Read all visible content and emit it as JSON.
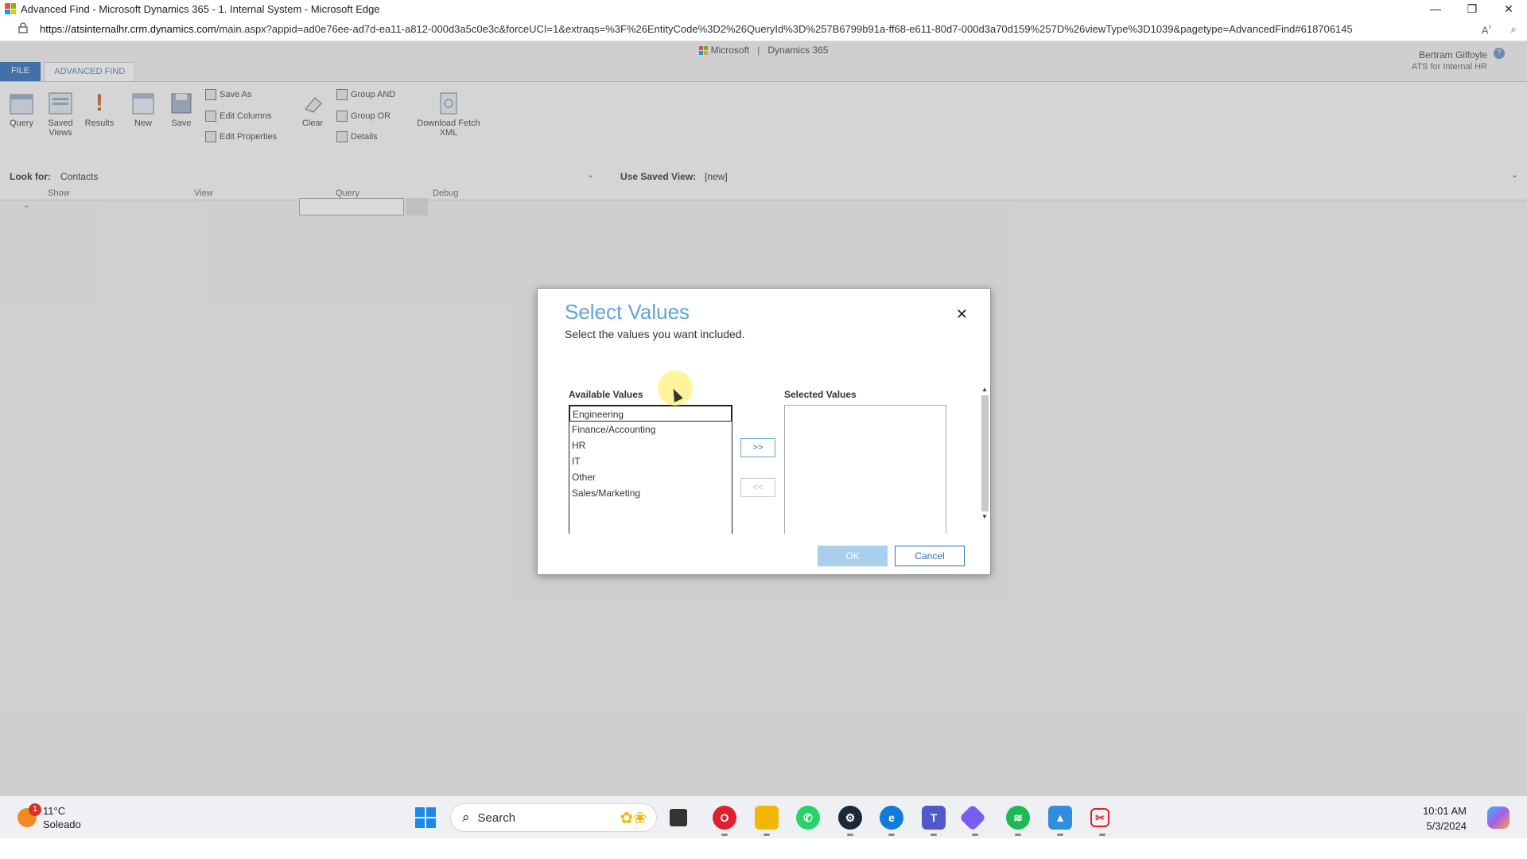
{
  "browser": {
    "window_title": "Advanced Find - Microsoft Dynamics 365 - 1. Internal System - Microsoft Edge",
    "url_host": "https://atsinternalhr.crm.dynamics.com",
    "url_path": "/main.aspx?appid=ad0e76ee-ad7d-ea11-a812-000d3a5c0e3c&forceUCI=1&extraqs=%3F%26EntityCode%3D2%26QueryId%3D%257B6799b91a-ff68-e611-80d7-000d3a70d159%257D%26viewType%3D1039&pagetype=AdvancedFind#618706145",
    "controls": {
      "minimize": "—",
      "restore": "❐",
      "close": "✕"
    }
  },
  "crm": {
    "header_brand": "Microsoft",
    "header_product": "Dynamics 365",
    "user_name": "Bertram Gilfoyle",
    "user_org": "ATS for Internal HR",
    "tabs": {
      "file": "FILE",
      "advanced_find": "ADVANCED FIND"
    },
    "ribbon": {
      "query": "Query",
      "saved_views": "Saved Views",
      "results": "Results",
      "new": "New",
      "save": "Save",
      "save_as": "Save As",
      "edit_columns": "Edit Columns",
      "edit_properties": "Edit Properties",
      "clear": "Clear",
      "group_and": "Group AND",
      "group_or": "Group OR",
      "details": "Details",
      "download_fetch_xml": "Download Fetch XML",
      "group_show": "Show",
      "group_view": "View",
      "group_query": "Query",
      "group_debug": "Debug"
    },
    "look_for_label": "Look for:",
    "look_for_value": "Contacts",
    "saved_view_label": "Use Saved View:",
    "saved_view_value": "[new]"
  },
  "dialog": {
    "title": "Select Values",
    "subtitle": "Select the values you want included.",
    "available_label": "Available Values",
    "selected_label": "Selected Values",
    "available_values": [
      "Engineering",
      "Finance/Accounting",
      "HR",
      "IT",
      "Other",
      "Sales/Marketing"
    ],
    "selected_item": "Engineering",
    "add_label": ">>",
    "remove_label": "<<",
    "ok_label": "OK",
    "cancel_label": "Cancel"
  },
  "taskbar": {
    "weather_temp": "11°C",
    "weather_desc": "Soleado",
    "weather_badge": "1",
    "search_placeholder": "Search",
    "time": "10:01 AM",
    "date": "5/3/2024"
  }
}
